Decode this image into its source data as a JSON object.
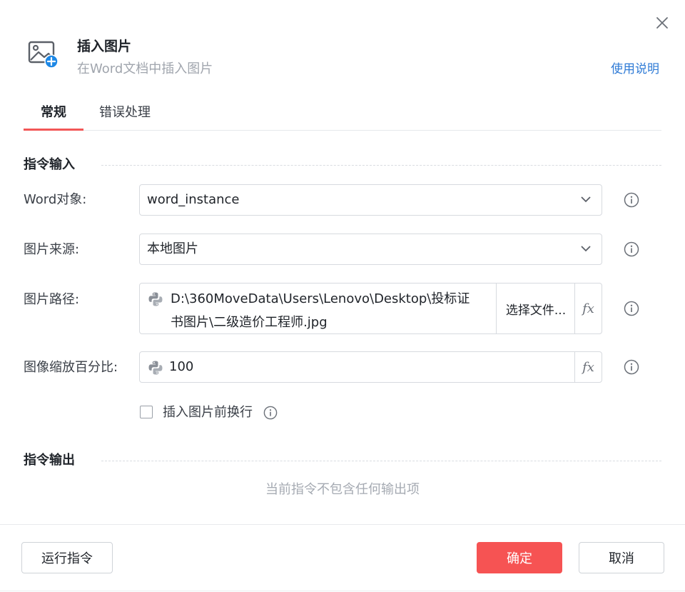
{
  "dialog": {
    "title": "插入图片",
    "subtitle": "在Word文档中插入图片",
    "help_link": "使用说明",
    "icon": "image-add-icon"
  },
  "tabs": [
    {
      "label": "常规",
      "active": true
    },
    {
      "label": "错误处理",
      "active": false
    }
  ],
  "input_section": {
    "title": "指令输入",
    "word_object": {
      "label": "Word对象:",
      "value": "word_instance"
    },
    "image_source": {
      "label": "图片来源:",
      "value": "本地图片"
    },
    "image_path": {
      "label": "图片路径:",
      "value_line1": "D:\\360MoveData\\Users\\Lenovo\\Desktop\\投标证",
      "value_line2": "书图片\\二级造价工程师.jpg",
      "choose_file": "选择文件...",
      "fx": "fx"
    },
    "scale": {
      "label": "图像缩放百分比:",
      "value": "100",
      "fx": "fx"
    },
    "newline_checkbox": {
      "label": "插入图片前换行",
      "checked": false
    }
  },
  "output_section": {
    "title": "指令输出",
    "empty_text": "当前指令不包含任何输出项"
  },
  "footer": {
    "run_label": "运行指令",
    "confirm_label": "确定",
    "cancel_label": "取消"
  },
  "colors": {
    "accent": "#f65353",
    "link": "#2f7bd6",
    "icon_blue": "#1e88e5"
  }
}
